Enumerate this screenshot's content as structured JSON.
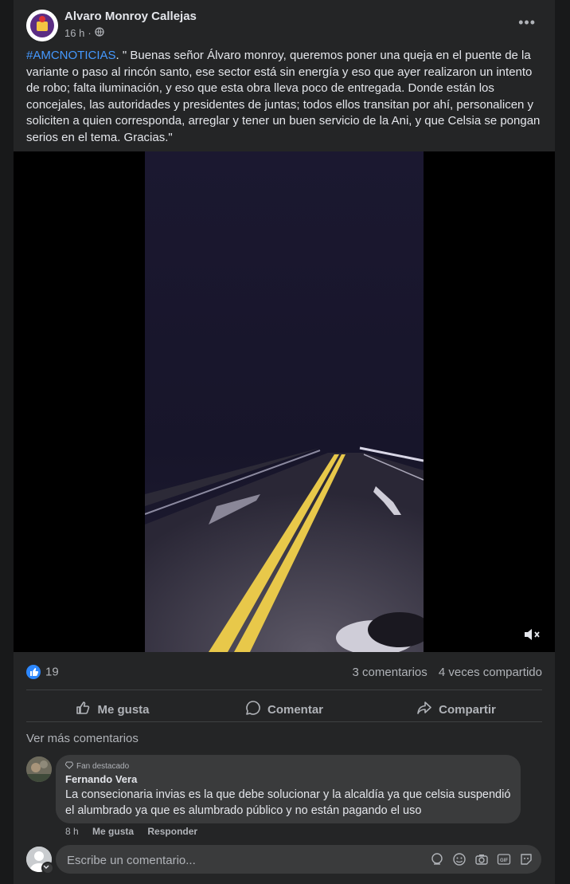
{
  "post": {
    "author": "Alvaro Monroy Callejas",
    "time": "16 h",
    "hashtag": "#AMCNOTICIAS",
    "text": ". \" Buenas señor Álvaro monroy, queremos poner una queja en el puente de la variante o paso al rincón santo, ese sector está  sin energía y eso que ayer realizaron un intento de robo; falta iluminación, y eso que esta obra lleva poco de entregada.  Donde están los concejales, las autoridades y presidentes de juntas;  todos ellos transitan por ahí,  personalicen y soliciten a quien corresponda, arreglar y tener un buen servicio de la Ani, y que Celsia se pongan serios en el tema. Gracias.\""
  },
  "stats": {
    "likes": "19",
    "comments": "3 comentarios",
    "shares": "4 veces compartido"
  },
  "actions": {
    "like": "Me gusta",
    "comment": "Comentar",
    "share": "Compartir"
  },
  "comments_section": {
    "more": "Ver más comentarios",
    "comment": {
      "badge": "Fan destacado",
      "name": "Fernando Vera",
      "text": "La consecionaria invias es la que debe solucionar y la alcaldía ya que celsia suspendió el alumbrado ya que es alumbrado público y no están pagando el uso",
      "time": "8 h",
      "like": "Me gusta",
      "reply": "Responder"
    },
    "input_placeholder": "Escribe un comentario..."
  },
  "colors": {
    "background": "#18191a",
    "card": "#242526",
    "accent": "#2d88ff",
    "hashtag": "#4599ff",
    "road_line": "#e8c84a"
  }
}
